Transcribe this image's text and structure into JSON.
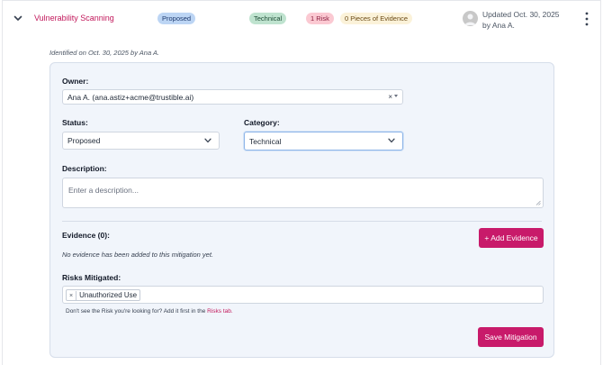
{
  "item": {
    "title": "Vulnerability Scanning",
    "status_badge": "Proposed",
    "category_badge": "Technical",
    "risk_badge": "1 Risk",
    "evidence_badge": "0 Pieces of Evidence",
    "updated_line1": "Updated Oct. 30, 2025",
    "updated_line2": "by Ana A.",
    "identified": "Identified on Oct. 30, 2025 by Ana A."
  },
  "form": {
    "owner_label": "Owner:",
    "owner_value": "Ana A. (ana.astiz+acme@trustible.ai)",
    "owner_clear": "×",
    "status_label": "Status:",
    "status_value": "Proposed",
    "category_label": "Category:",
    "category_value": "Technical",
    "description_label": "Description:",
    "description_placeholder": "Enter a description...",
    "evidence_label": "Evidence (0):",
    "add_evidence_button": "+ Add Evidence",
    "no_evidence_text": "No evidence has been added to this mitigation yet.",
    "risks_label": "Risks Mitigated:",
    "risk_tag_remove": "×",
    "risk_tag": "Unauthorized Use",
    "hint_text": "Don't see the Risk you're looking for? Add it first in the",
    "hint_link": "Risks tab.",
    "save_button": "Save Mitigation"
  },
  "colors": {
    "accent": "#c81a6a",
    "card_bg": "#f1f5fb",
    "proposed_badge": "#bcd5f4",
    "technical_badge": "#bfe3cf",
    "risk_badge": "#fbc9d2",
    "evidence_badge": "#fbf2d9"
  },
  "icons": {
    "expand": "chevron-down-icon",
    "avatar": "user-avatar-icon",
    "menu": "kebab-menu-icon",
    "select": "chevron-down-icon",
    "resize": "resize-handle-icon"
  }
}
